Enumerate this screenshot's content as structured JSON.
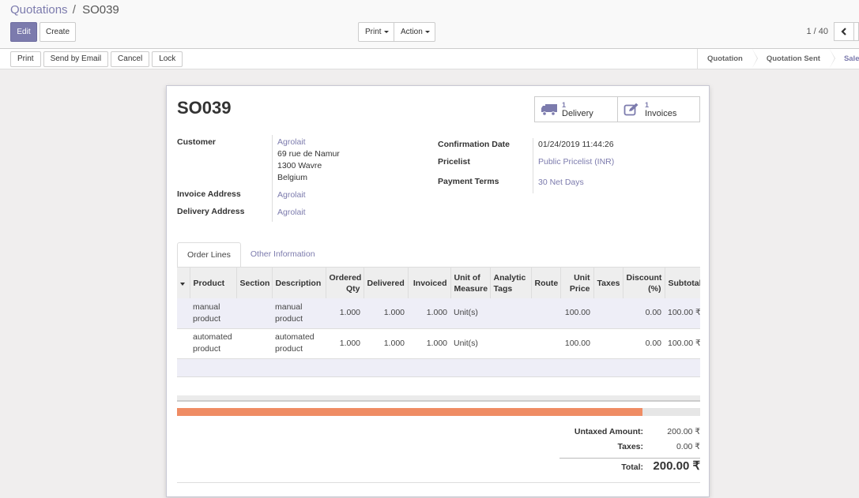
{
  "breadcrumb": {
    "parent": "Quotations",
    "separator": "/",
    "current": "SO039"
  },
  "toolbar": {
    "edit_label": "Edit",
    "create_label": "Create",
    "print_label": "Print",
    "action_label": "Action"
  },
  "pager": {
    "value": "1 / 40",
    "prev_icon": "chevron-left-icon"
  },
  "statusbar": {
    "buttons": [
      "Print",
      "Send by Email",
      "Cancel",
      "Lock"
    ],
    "stages": [
      {
        "label": "Quotation",
        "active": false
      },
      {
        "label": "Quotation Sent",
        "active": false
      },
      {
        "label": "Sales Order",
        "active": true
      }
    ]
  },
  "record": {
    "name": "SO039",
    "smart_buttons": [
      {
        "icon": "truck-icon",
        "value": "1",
        "label": "Delivery"
      },
      {
        "icon": "edit-icon",
        "value": "1",
        "label": "Invoices"
      }
    ],
    "left_fields": {
      "customer_label": "Customer",
      "customer_name": "Agrolait",
      "customer_address": [
        "69 rue de Namur",
        "1300 Wavre",
        "Belgium"
      ],
      "invoice_address_label": "Invoice Address",
      "invoice_address": "Agrolait",
      "delivery_address_label": "Delivery Address",
      "delivery_address": "Agrolait"
    },
    "right_fields": {
      "confirmation_date_label": "Confirmation Date",
      "confirmation_date": "01/24/2019 11:44:26",
      "pricelist_label": "Pricelist",
      "pricelist": "Public Pricelist (INR)",
      "payment_terms_label": "Payment Terms",
      "payment_terms": "30 Net Days"
    }
  },
  "tabs": [
    "Order Lines",
    "Other Information"
  ],
  "order_lines": {
    "columns": [
      "Product",
      "Section",
      "Description",
      "Ordered Qty",
      "Delivered",
      "Invoiced",
      "Unit of Measure",
      "Analytic Tags",
      "Route",
      "Unit Price",
      "Taxes",
      "Discount (%)",
      "Subtotal"
    ],
    "rows": [
      {
        "product": "manual product",
        "section": "",
        "description": "manual product",
        "ordered_qty": "1.000",
        "delivered": "1.000",
        "invoiced": "1.000",
        "uom": "Unit(s)",
        "analytic_tags": "",
        "route": "",
        "unit_price": "100.00",
        "taxes": "",
        "discount": "0.00",
        "subtotal": "100.00 ₹"
      },
      {
        "product": "automated product",
        "section": "",
        "description": "automated product",
        "ordered_qty": "1.000",
        "delivered": "1.000",
        "invoiced": "1.000",
        "uom": "Unit(s)",
        "analytic_tags": "",
        "route": "",
        "unit_price": "100.00",
        "taxes": "",
        "discount": "0.00",
        "subtotal": "100.00 ₹"
      }
    ],
    "scroll_fraction_visible": 0.89
  },
  "totals": {
    "untaxed_label": "Untaxed Amount:",
    "untaxed_value": "200.00 ₹",
    "taxes_label": "Taxes:",
    "taxes_value": "0.00 ₹",
    "total_label": "Total:",
    "total_value": "200.00 ₹"
  },
  "colors": {
    "brand": "#7c7bad",
    "scrollbar_thumb": "#ef8c64"
  }
}
